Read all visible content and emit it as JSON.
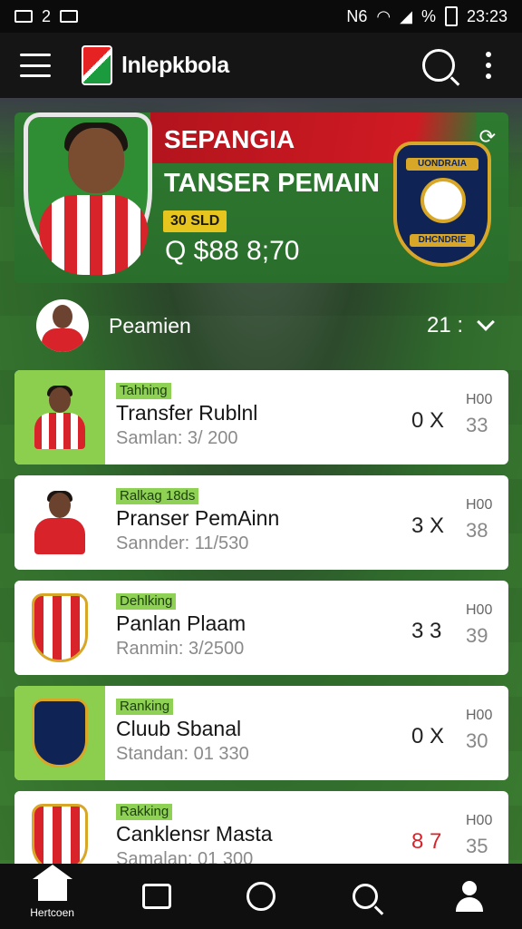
{
  "status_bar": {
    "left_text": "2",
    "time": "23:23",
    "network_label": "N6",
    "battery_label": "%"
  },
  "app_bar": {
    "app_name": "lnlepkbola"
  },
  "hero": {
    "name": "SEPANGIA",
    "subtitle": "TANSER PEMAIN",
    "badge": "30 SLD",
    "value": "Q $88 8;70",
    "refresh_icon": "refresh-icon",
    "crest_top": "UONDRAIA",
    "crest_bottom": "DHCNDRIE"
  },
  "summary": {
    "label": "Peamien",
    "count": "21 :"
  },
  "list": [
    {
      "tag": "Tahhing",
      "title": "Transfer Rublnl",
      "subtitle": "Samlan: 3/ 200",
      "stat": "0 X",
      "meta_top": "H00",
      "meta_bottom": "33",
      "thumb": "player",
      "thumb_bg": "green",
      "stat_color": "#222222"
    },
    {
      "tag": "Ralkag 18ds",
      "title": "Pranser PemAinn",
      "subtitle": "Sannder: 11/530",
      "stat": "3 X",
      "meta_top": "H00",
      "meta_bottom": "38",
      "thumb": "player-solid",
      "thumb_bg": "white",
      "stat_color": "#222222"
    },
    {
      "tag": "Dehlking",
      "title": "Panlan Plaam",
      "subtitle": "Ranmin: 3/2500",
      "stat": "3 3",
      "meta_top": "H00",
      "meta_bottom": "39",
      "thumb": "crest-striped",
      "thumb_bg": "white",
      "stat_color": "#222222"
    },
    {
      "tag": "Ranking",
      "title": "Cluub Sbanal",
      "subtitle": "Standan: 01 330",
      "stat": "0 X",
      "meta_top": "H00",
      "meta_bottom": "30",
      "thumb": "crest-navy",
      "thumb_bg": "green",
      "stat_color": "#222222"
    },
    {
      "tag": "Rakking",
      "title": "Canklensr Masta",
      "subtitle": "Samalan: 01 300",
      "stat": "8 7",
      "meta_top": "H00",
      "meta_bottom": "35",
      "thumb": "crest-striped",
      "thumb_bg": "white",
      "stat_color": "#d9232a"
    }
  ],
  "bottom_nav": {
    "home_label": "Hertcoen",
    "items": [
      "home-icon",
      "transfer-icon",
      "circle-icon",
      "search-icon",
      "profile-icon"
    ]
  },
  "colors": {
    "accent_green": "#8ccf4f",
    "accent_red": "#d9232a",
    "badge_yellow": "#e6c51e",
    "crest_navy": "#0f2454",
    "crest_gold": "#d9a728"
  }
}
